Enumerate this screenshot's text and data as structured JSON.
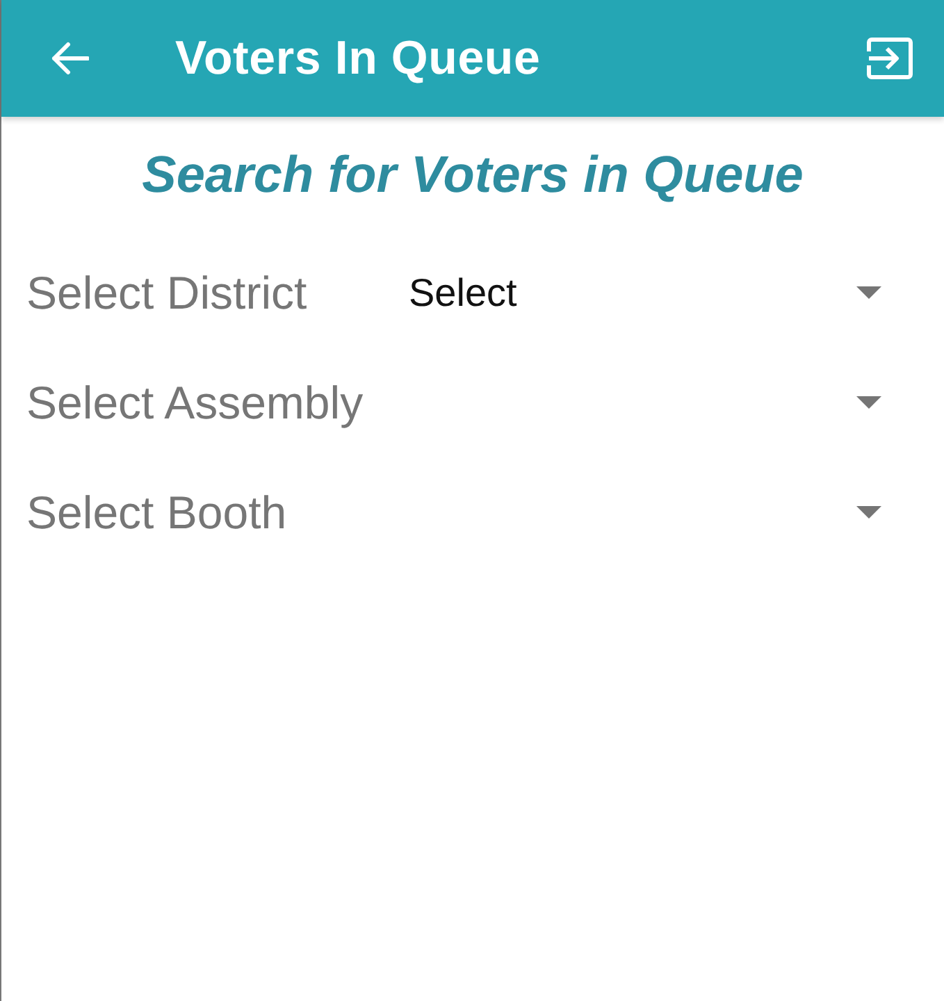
{
  "app_bar": {
    "title": "Voters In Queue"
  },
  "heading": "Search for Voters in Queue",
  "dropdowns": [
    {
      "label": "Select District",
      "value": "Select"
    },
    {
      "label": "Select Assembly"
    },
    {
      "label": "Select Booth"
    }
  ]
}
